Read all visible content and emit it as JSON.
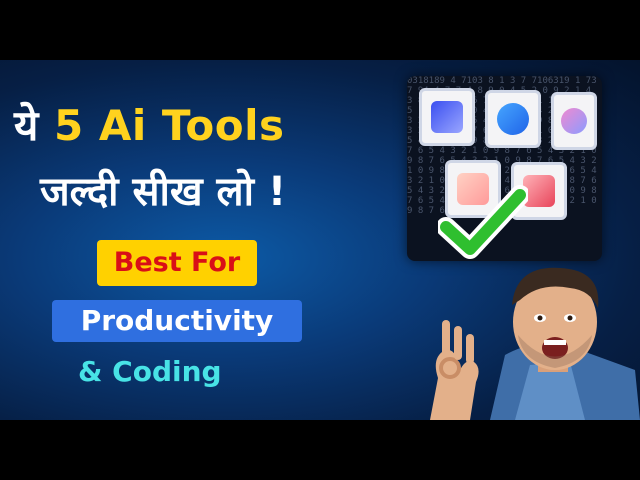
{
  "headline": {
    "prefix": "ये ",
    "accent": "5 Ai Tools",
    "line2": "जल्दी सीख लो !"
  },
  "badges": {
    "best_for": "Best For",
    "productivity": "Productivity"
  },
  "tagline": "& Coding",
  "code_background": "0318189 4 7103 8 1 3 7 7106319 1 73 7 94 4 7 7 4 8 9 0 4 5 2 0 9 2 1 4 3 8 5 0 2 7 6 7 0 4 8 3 1 1 6 7 3 2 5 1 9 0 2 4 0 4 9 0 6 1 4 2 7 9 8 4 3 2 1 0 8 6 5 4 3 2 1 0 9 8 7 6 5 4 3 2 1 0 9 8 7 6 5 4 3 2 1 0 9 8 7 6 5 4 3 2 1 0 9 8 7 6 5 4 3 2 1 0 9 8 7 6 5 4 3 2 1 0 9 8 7 6 5 4 3 2 1 0 9 8 7 6 5 4 3 2 1 0 9 8 7 6 5 4 3 2 1 0 9 8 7 6 5 4 3 2 1 0 9 8 7 6 5 4 3 2 1 0 9 8 7 6 5 4 3 2 1 0 9 8 7 6 5 4 3 2 1 0 9 8 7 6 5 4 3 2 1 0 9 8 7 6 5 4 3 2 1 0 9 8 7 6 5 4 3 2 1 0 9 8 7 6 5 4 3 2 1",
  "icons": {
    "check": "check-icon",
    "tools": [
      "tool-icon-1",
      "tool-icon-2",
      "tool-icon-3",
      "tool-icon-4",
      "tool-icon-5"
    ]
  },
  "colors": {
    "accent_yellow": "#ffd21e",
    "badge_red_text": "#d90f17",
    "badge_blue": "#2f6fe0",
    "tagline_cyan": "#48e3e6",
    "check_green": "#2fbf2f"
  }
}
